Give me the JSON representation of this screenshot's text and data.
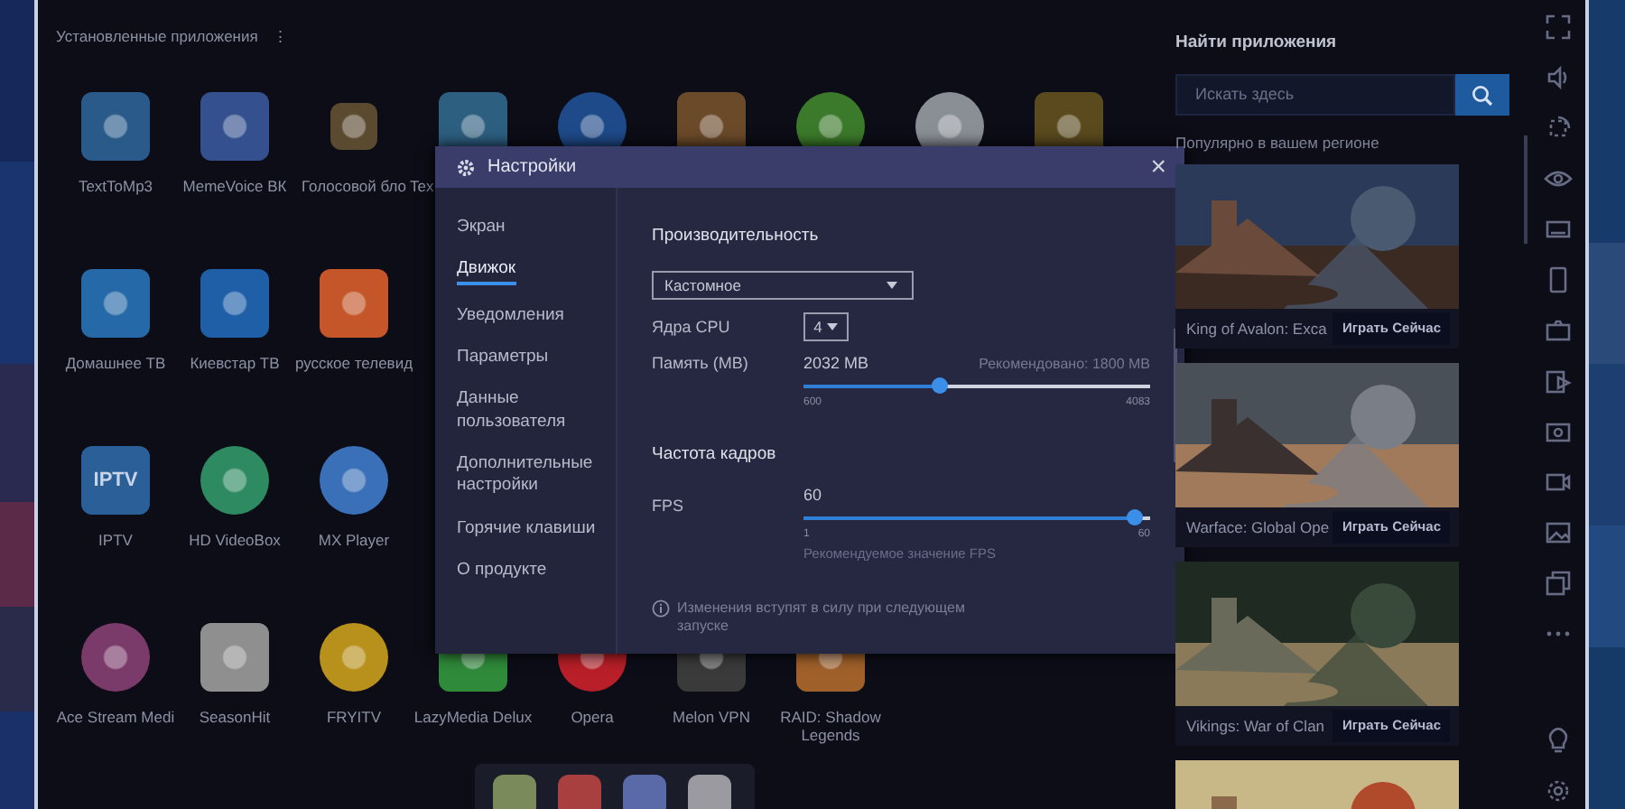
{
  "home": {
    "title": "Установленные приложения",
    "menu": "⋮",
    "rows": [
      [
        {
          "label": "TextToMp3",
          "color": "#2a5a8a",
          "kind": "tile"
        },
        {
          "label": "MemeVoice ВК",
          "color": "#34508e",
          "kind": "tile"
        },
        {
          "label": "Голосовой бло",
          "color": "#5a4a30",
          "kind": "small"
        },
        {
          "label": "Tex",
          "color": "#2d5f80",
          "kind": "tile",
          "clipped": true
        },
        {
          "color": "#1e4a8a",
          "kind": "round"
        },
        {
          "color": "#6b4a2a",
          "kind": "tile"
        },
        {
          "color": "#3b7a2a",
          "kind": "round"
        },
        {
          "color": "#8a8f96",
          "kind": "round"
        },
        {
          "color": "#5a4a1e",
          "kind": "tile"
        }
      ],
      [
        {
          "label": "Домашнее ТВ",
          "color": "#2569a8",
          "kind": "tile"
        },
        {
          "label": "Киевстар ТВ",
          "color": "#1f5fa8",
          "kind": "tile"
        },
        {
          "label": "русское телевид",
          "color": "#c4562a",
          "kind": "tile"
        }
      ],
      [
        {
          "label": "IPTV",
          "color": "#2a5f98",
          "kind": "tile",
          "icon_text": "IPTV"
        },
        {
          "label": "HD VideoBox",
          "color": "#2e8a60",
          "kind": "round"
        },
        {
          "label": "MX Player",
          "color": "#3a70b8",
          "kind": "round"
        }
      ],
      [
        {
          "label": "Ace Stream Medi",
          "color": "#7a3a6a",
          "kind": "round"
        },
        {
          "label": "SeasonHit",
          "color": "#8f8f8f",
          "kind": "tile"
        },
        {
          "label": "FRYITV",
          "color": "#b8901c",
          "kind": "round"
        },
        {
          "label": "LazyMedia Delux",
          "color": "#2f8a3a",
          "kind": "tile"
        },
        {
          "label": "Opera",
          "color": "#b81f28",
          "kind": "round"
        },
        {
          "label": "Melon VPN",
          "color": "#3a3a3a",
          "kind": "tile"
        },
        {
          "label": "RAID: Shadow Legends",
          "color": "#a0602a",
          "kind": "tile"
        }
      ]
    ],
    "dock": [
      {
        "color": "#7a8a5a"
      },
      {
        "color": "#a84040"
      },
      {
        "color": "#5a6aa8"
      },
      {
        "color": "#9a9aa0"
      }
    ]
  },
  "dialog": {
    "title": "Настройки",
    "close": "×",
    "nav": [
      {
        "label": "Экран",
        "selected": false
      },
      {
        "label": "Движок",
        "selected": true
      },
      {
        "label": "Уведомления",
        "selected": false
      },
      {
        "label": "Параметры",
        "selected": false
      },
      {
        "label": "Данные пользователя",
        "selected": false
      },
      {
        "label": "Дополнительные настройки",
        "selected": false
      },
      {
        "label": "Горячие клавиши",
        "selected": false
      },
      {
        "label": "О продукте",
        "selected": false
      }
    ],
    "performance": {
      "heading": "Производительность",
      "mode": "Кастомное",
      "cpu_label": "Ядра CPU",
      "cpu_value": "4",
      "memory_label": "Память (MB)",
      "memory_value": "2032 MB",
      "memory_hint": "Рекомендовано: 1800 MB",
      "memory_slider": {
        "level": 0.411
      },
      "memory_min": "600",
      "memory_max": "4083"
    },
    "framerate": {
      "heading": "Частота кадров",
      "fps_label": "FPS",
      "fps_value": "60",
      "fps_slider": {
        "level": 1.0
      },
      "fps_min": "1",
      "fps_max": "60",
      "fps_hint": "Рекомендуемое значение FPS"
    },
    "notice": "Изменения вступят в силу при следующем запуске"
  },
  "store": {
    "title": "Найти приложения",
    "search": {
      "placeholder": "Искать здесь"
    },
    "section": "Популярно в вашем регионе",
    "cards": [
      {
        "title": "King of Avalon: Exca",
        "button": "Играть Сейчас"
      },
      {
        "title": "Warface: Global Ope",
        "button": "Играть Сейчас"
      },
      {
        "title": "Vikings: War of Clan",
        "button": "Играть Сейчас"
      },
      {
        "kind": "picture"
      }
    ]
  }
}
